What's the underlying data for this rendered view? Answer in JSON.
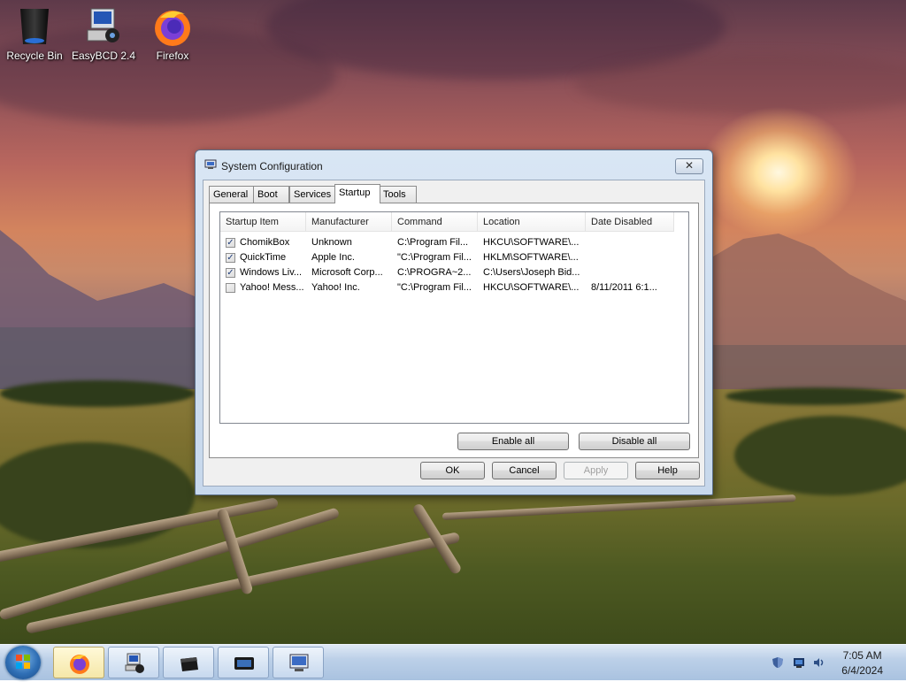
{
  "desktop": {
    "icons": [
      {
        "label": "Recycle Bin"
      },
      {
        "label": "EasyBCD 2.4"
      },
      {
        "label": "Firefox"
      }
    ]
  },
  "dialog": {
    "title": "System Configuration",
    "close_glyph": "✕",
    "tabs": [
      {
        "label": "General"
      },
      {
        "label": "Boot"
      },
      {
        "label": "Services"
      },
      {
        "label": "Startup"
      },
      {
        "label": "Tools"
      }
    ],
    "active_tab": "Startup",
    "columns": [
      "Startup Item",
      "Manufacturer",
      "Command",
      "Location",
      "Date Disabled"
    ],
    "rows": [
      {
        "checked": true,
        "item": "ChomikBox",
        "manufacturer": "Unknown",
        "command": "C:\\Program Fil...",
        "location": "HKCU\\SOFTWARE\\...",
        "date_disabled": ""
      },
      {
        "checked": true,
        "item": "QuickTime",
        "manufacturer": "Apple Inc.",
        "command": "\"C:\\Program Fil...",
        "location": "HKLM\\SOFTWARE\\...",
        "date_disabled": ""
      },
      {
        "checked": true,
        "item": "Windows Liv...",
        "manufacturer": "Microsoft Corp...",
        "command": "C:\\PROGRA~2...",
        "location": "C:\\Users\\Joseph Bid...",
        "date_disabled": ""
      },
      {
        "checked": false,
        "item": "Yahoo! Mess...",
        "manufacturer": "Yahoo! Inc.",
        "command": "\"C:\\Program Fil...",
        "location": "HKCU\\SOFTWARE\\...",
        "date_disabled": "8/11/2011 6:1..."
      }
    ],
    "buttons": {
      "enable_all": "Enable all",
      "disable_all": "Disable all",
      "ok": "OK",
      "cancel": "Cancel",
      "apply": "Apply",
      "help": "Help"
    }
  },
  "taskbar": {
    "items": [
      {
        "icon": "firefox-icon",
        "active": true
      },
      {
        "icon": "easybcd-icon",
        "active": false
      },
      {
        "icon": "drive-icon",
        "active": false
      },
      {
        "icon": "monitor-icon",
        "active": false
      },
      {
        "icon": "system-config-icon",
        "active": false
      }
    ],
    "tray_icons": [
      "security-shield-icon",
      "network-icon",
      "volume-icon"
    ],
    "clock": {
      "time": "7:05 AM",
      "date": "6/4/2024"
    }
  },
  "colors": {
    "title_bar": "#c7d8ec",
    "taskbar": "#bcd0e8",
    "active_taskbar_item": "#f5e7a8",
    "checkmark": "#1f3d7a"
  }
}
